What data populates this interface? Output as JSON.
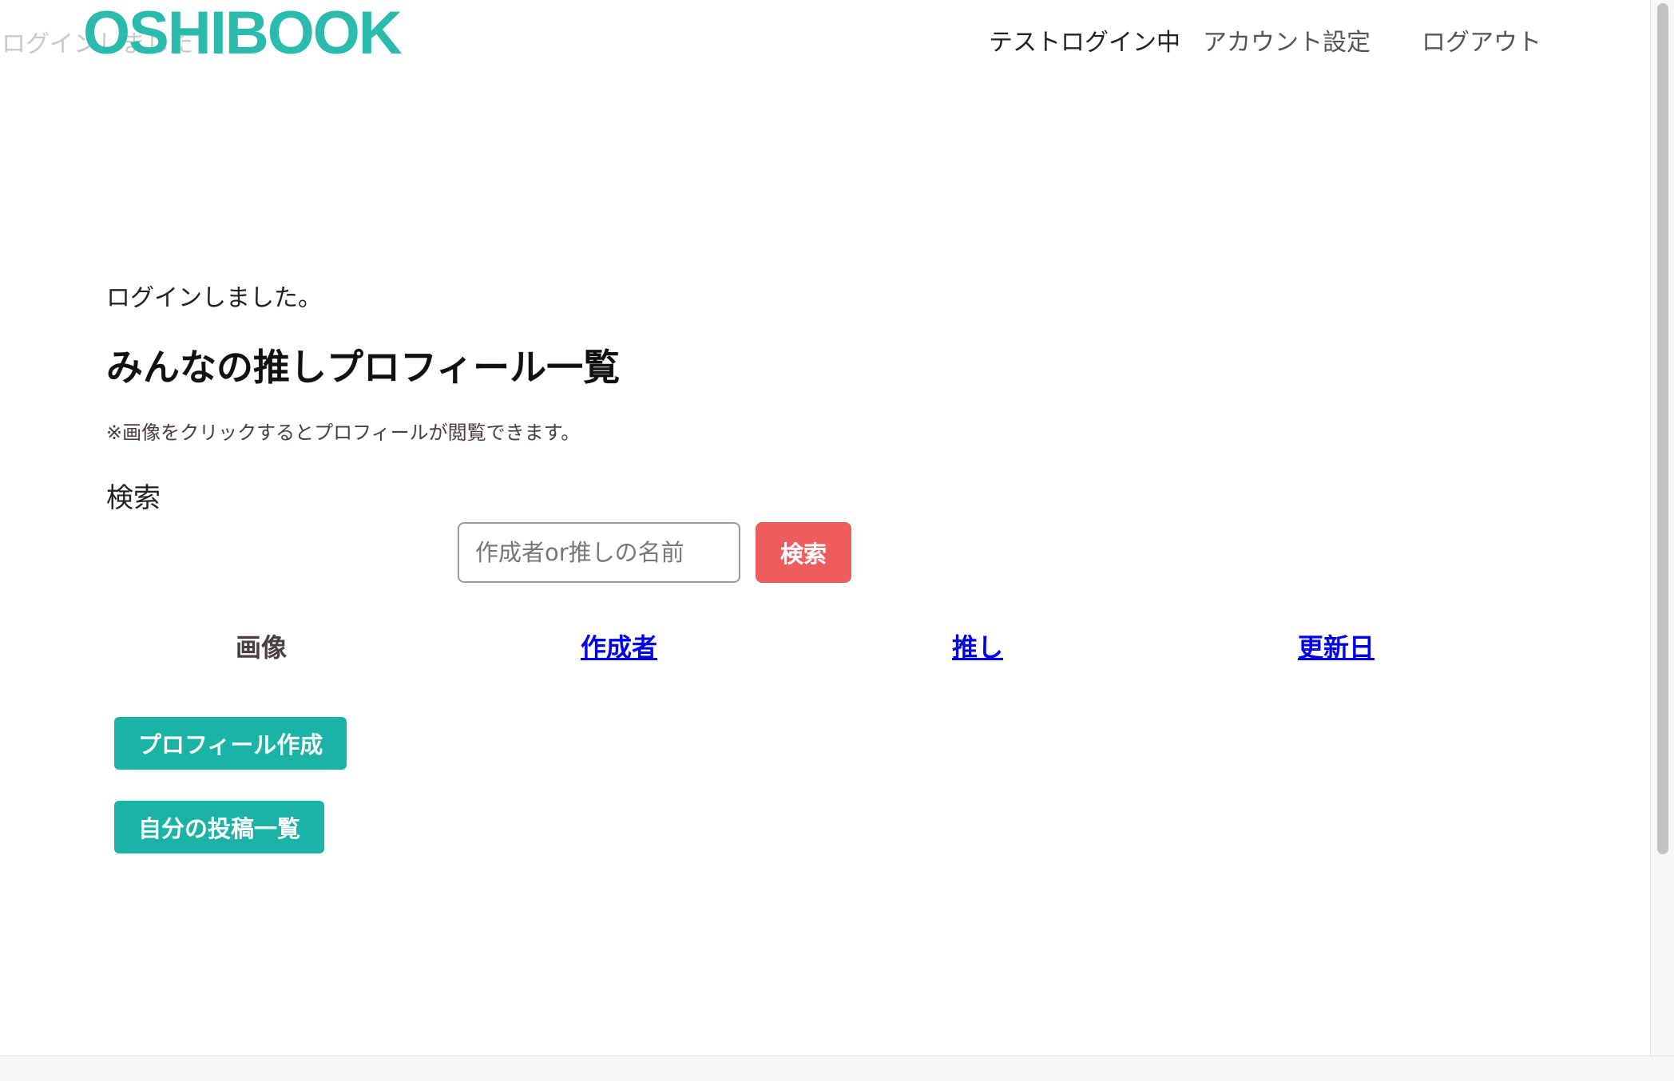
{
  "header": {
    "logo": "OSHIBOOK",
    "flash_overlay": "ログインしました",
    "nav": {
      "current_user": "テストログイン中",
      "account_settings": "アカウント設定",
      "logout": "ログアウト"
    }
  },
  "main": {
    "notice": "ログインしました。",
    "title": "みんなの推しプロフィール一覧",
    "hint": "※画像をクリックするとプロフィールが閲覧できます。",
    "search": {
      "label": "検索",
      "placeholder": "作成者or推しの名前",
      "value": "",
      "button": "検索"
    },
    "table": {
      "columns": [
        "画像",
        "作成者",
        "推し",
        "更新日"
      ],
      "rows": []
    },
    "actions": {
      "create_profile": "プロフィール作成",
      "my_posts": "自分の投稿一覧"
    }
  },
  "colors": {
    "brand": "#2bbbad",
    "action_button": "#1ab3a6",
    "search_button": "#ee5d5d",
    "link": "#0000ee"
  }
}
